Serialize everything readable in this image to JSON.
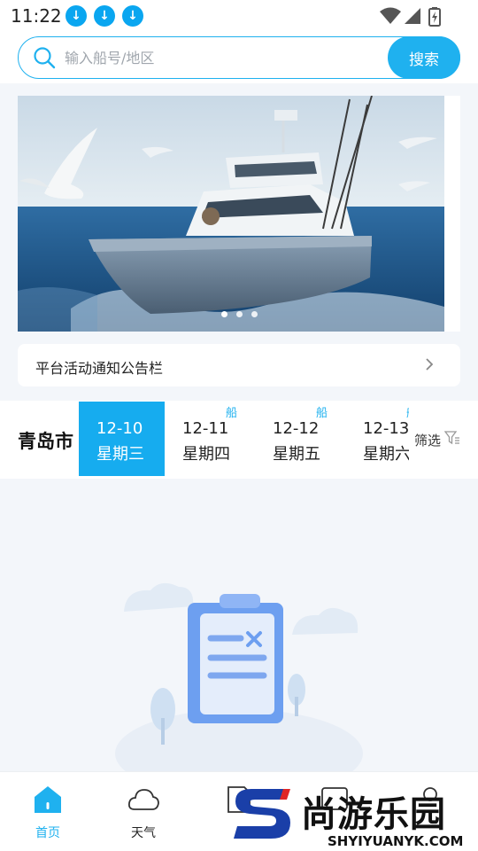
{
  "status_bar": {
    "time": "11:22"
  },
  "search": {
    "placeholder": "输入船号/地区",
    "button_label": "搜索"
  },
  "notice": {
    "text": "平台活动通知公告栏"
  },
  "banner": {
    "slide_count": 3,
    "active_index": 0
  },
  "date_strip": {
    "city": "青岛市",
    "dates": [
      {
        "date": "12-10",
        "weekday": "星期三",
        "tag": "",
        "selected": true
      },
      {
        "date": "12-11",
        "weekday": "星期四",
        "tag": "船",
        "selected": false
      },
      {
        "date": "12-12",
        "weekday": "星期五",
        "tag": "船",
        "selected": false
      },
      {
        "date": "12-13",
        "weekday": "星期六",
        "tag": "船",
        "selected": false
      }
    ],
    "filter_label": "筛选"
  },
  "bottom_nav": [
    {
      "label": "首页",
      "icon": "home-icon",
      "active": true
    },
    {
      "label": "天气",
      "icon": "cloud-icon",
      "active": false
    },
    {
      "label": "",
      "icon": "document-icon",
      "active": false
    },
    {
      "label": "",
      "icon": "message-icon",
      "active": false
    },
    {
      "label": "",
      "icon": "user-icon",
      "active": false
    }
  ],
  "watermark": {
    "cn": "尚游乐园",
    "en": "SHYIYUANYK.COM"
  },
  "colors": {
    "accent": "#1fb1ef",
    "selected_tab": "#16acef",
    "background": "#f3f6fa"
  }
}
